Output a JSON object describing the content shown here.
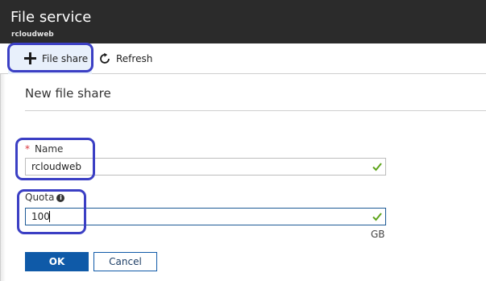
{
  "header": {
    "title": "File service",
    "subtitle": "rcloudweb"
  },
  "toolbar": {
    "file_share_label": "File share",
    "refresh_label": "Refresh",
    "file_share_icon": "plus-icon",
    "refresh_icon": "refresh-icon"
  },
  "panel": {
    "title": "New file share",
    "name_field": {
      "required_marker": "*",
      "label": "Name",
      "value": "rcloudweb",
      "valid": true
    },
    "quota_field": {
      "label": "Quota",
      "info_glyph": "i",
      "value": "100",
      "unit": "GB",
      "valid": true
    },
    "ok_label": "OK",
    "cancel_label": "Cancel"
  },
  "colors": {
    "header_bg": "#2b2b2b",
    "primary": "#0f5aa8",
    "valid_check": "#5ea41b",
    "annotation": "#3b3fc4",
    "required": "#d9363e"
  }
}
